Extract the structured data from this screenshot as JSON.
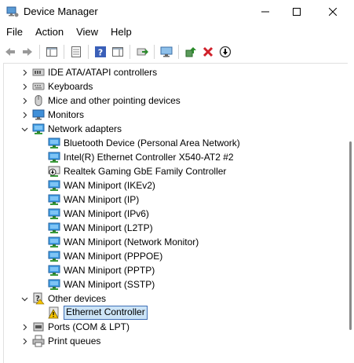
{
  "window": {
    "title": "Device Manager"
  },
  "menu": [
    "File",
    "Action",
    "View",
    "Help"
  ],
  "toolbar_icons": [
    "back-arrow-icon",
    "forward-arrow-icon",
    "show-hide-tree-icon",
    "properties-icon",
    "help-icon",
    "action-pane-icon",
    "scan-hardware-icon",
    "display-icon",
    "update-driver-icon",
    "uninstall-x-icon",
    "disable-device-icon"
  ],
  "tree": {
    "categories_top": [
      {
        "label": "IDE ATA/ATAPI controllers",
        "icon": "ide-controller-icon"
      },
      {
        "label": "Keyboards",
        "icon": "keyboard-icon"
      },
      {
        "label": "Mice and other pointing devices",
        "icon": "mouse-icon"
      },
      {
        "label": "Monitors",
        "icon": "monitor-icon"
      }
    ],
    "network": {
      "label": "Network adapters",
      "children": [
        "Bluetooth Device (Personal Area Network)",
        "Intel(R) Ethernet Controller X540-AT2 #2",
        "Realtek Gaming GbE Family Controller",
        "WAN Miniport (IKEv2)",
        "WAN Miniport (IP)",
        "WAN Miniport (IPv6)",
        "WAN Miniport (L2TP)",
        "WAN Miniport (Network Monitor)",
        "WAN Miniport (PPPOE)",
        "WAN Miniport (PPTP)",
        "WAN Miniport (SSTP)"
      ]
    },
    "other": {
      "label": "Other devices",
      "children": [
        "Ethernet Controller"
      ]
    },
    "categories_bottom": [
      {
        "label": "Ports (COM & LPT)",
        "icon": "port-icon"
      },
      {
        "label": "Print queues",
        "icon": "printer-icon"
      }
    ]
  }
}
